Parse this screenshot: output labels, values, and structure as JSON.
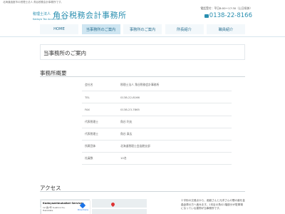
{
  "header": {
    "top_line": "北海道函館市の税理士法人 角谷税務会計事務所です。",
    "logo_prefix": "税理士法人",
    "logo_name": "角谷税務会計事務所",
    "logo_english": "Kadoya Tax Accountant Co.",
    "hours": "電話受付：平日8:00〜17:30（土日祝休）",
    "phone": "0138-22-8166",
    "phone_icon": "phone-icon"
  },
  "nav": {
    "items": [
      {
        "label": "HOME"
      },
      {
        "label": "当事務所のご案内"
      },
      {
        "label": "事務所のご案内"
      },
      {
        "label": "所長紹介"
      },
      {
        "label": "職員紹介"
      }
    ],
    "active_index": 1,
    "active_color": "#cfe6f2"
  },
  "page": {
    "title": "当事務所のご案内",
    "section_title": "事務所概要"
  },
  "office_table": [
    {
      "label": "会社名",
      "value": "税理士法人 角谷税務会計事務所"
    },
    {
      "label": "TEL",
      "value": "0138-22-8166"
    },
    {
      "label": "FAX",
      "value": "0138-23-7865"
    },
    {
      "label": "代表税理士",
      "value": "角谷 利夫"
    },
    {
      "label": "代表税理士",
      "value": "角谷 真広"
    },
    {
      "label": "所属団体",
      "value": "北海道税理士会函館支部"
    },
    {
      "label": "社員数",
      "value": "10名"
    }
  ],
  "access": {
    "title": "アクセス",
    "map_name": "Kadoyazeimukaikei Services",
    "map_address": "12-番7号 Suehirocho, Hakodate",
    "map_directions": "Directions",
    "text": "十字街の交差点から、函館さんと元洋さんの間の道を金森倉庫の方へ進みます。1本目の角の1階部分が駐車場になっている建物が当事務所です。"
  },
  "colors": {
    "accent": "#2a8fb0",
    "nav_text": "#2a6f90"
  }
}
